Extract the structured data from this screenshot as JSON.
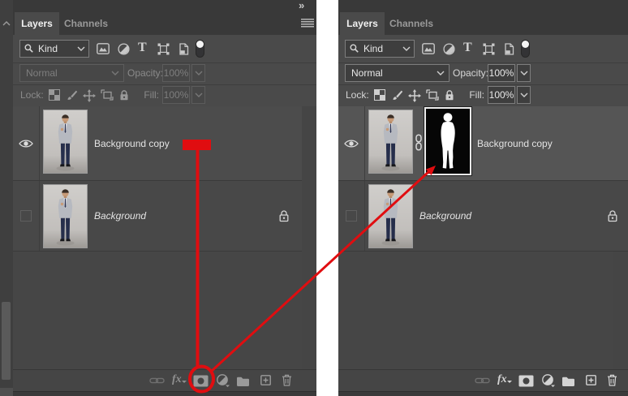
{
  "chrome": {
    "collapse_arrows": "»",
    "type_glyph": "T"
  },
  "left_panel": {
    "tabs": [
      "Layers",
      "Channels"
    ],
    "filter": {
      "kind": "Kind"
    },
    "blend": {
      "mode": "Normal",
      "opacity_label": "Opacity:",
      "opacity_value": "100%"
    },
    "lock": {
      "label": "Lock:",
      "fill_label": "Fill:",
      "fill_value": "100%"
    },
    "layers": [
      {
        "name": "Background copy",
        "visible": true,
        "has_mask": false
      },
      {
        "name": "Background",
        "visible": false,
        "locked": true
      }
    ],
    "toolbar": {
      "fx": "fx"
    }
  },
  "right_panel": {
    "tabs": [
      "Layers",
      "Channels"
    ],
    "filter": {
      "kind": "Kind"
    },
    "blend": {
      "mode": "Normal",
      "opacity_label": "Opacity:",
      "opacity_value": "100%"
    },
    "lock": {
      "label": "Lock:",
      "fill_label": "Fill:",
      "fill_value": "100%"
    },
    "layers": [
      {
        "name": "Background copy",
        "visible": true,
        "has_mask": true
      },
      {
        "name": "Background",
        "visible": false,
        "locked": true
      }
    ],
    "toolbar": {
      "fx": "fx"
    }
  },
  "annotation": {
    "color": "#e00d10"
  }
}
